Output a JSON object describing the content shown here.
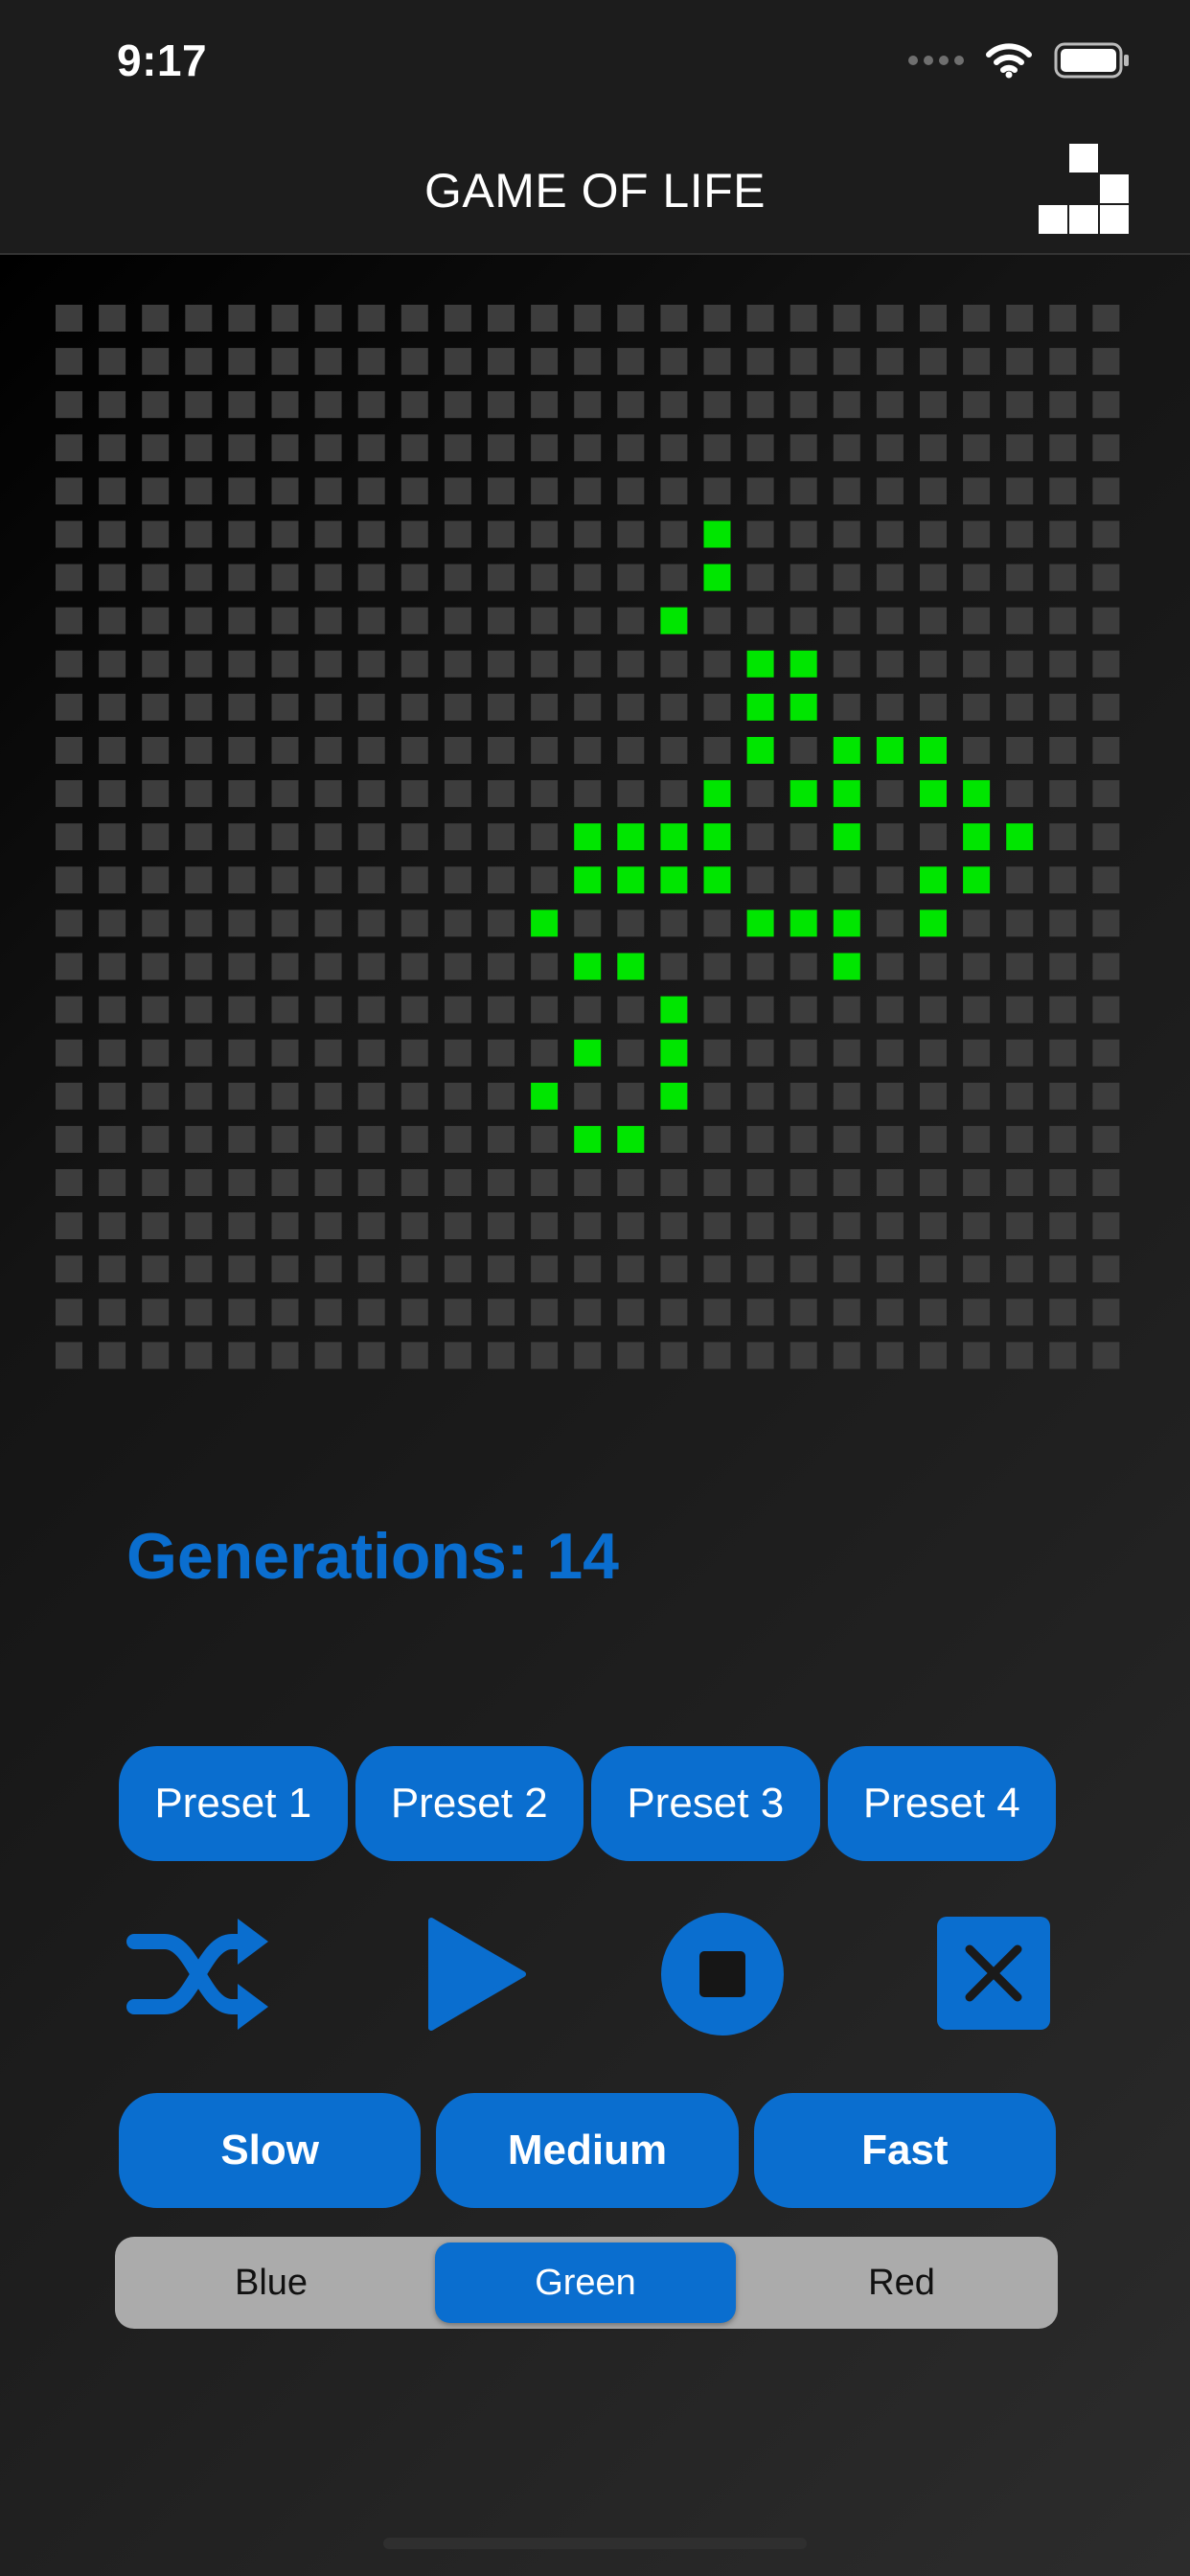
{
  "status": {
    "time": "9:17"
  },
  "nav": {
    "title": "GAME OF LIFE",
    "icon": "blocks-icon"
  },
  "grid": {
    "rows": 25,
    "cols": 25,
    "alive_color": "#00e600",
    "dead_color": "#3d3d3d",
    "alive_cells": [
      [
        5,
        15
      ],
      [
        6,
        15
      ],
      [
        7,
        14
      ],
      [
        8,
        16
      ],
      [
        8,
        17
      ],
      [
        9,
        16
      ],
      [
        9,
        17
      ],
      [
        10,
        16
      ],
      [
        10,
        18
      ],
      [
        10,
        19
      ],
      [
        10,
        20
      ],
      [
        11,
        15
      ],
      [
        11,
        17
      ],
      [
        11,
        18
      ],
      [
        11,
        20
      ],
      [
        11,
        21
      ],
      [
        12,
        12
      ],
      [
        12,
        13
      ],
      [
        12,
        14
      ],
      [
        12,
        15
      ],
      [
        12,
        18
      ],
      [
        12,
        21
      ],
      [
        12,
        22
      ],
      [
        13,
        12
      ],
      [
        13,
        13
      ],
      [
        13,
        14
      ],
      [
        13,
        15
      ],
      [
        13,
        20
      ],
      [
        13,
        21
      ],
      [
        14,
        11
      ],
      [
        14,
        16
      ],
      [
        14,
        17
      ],
      [
        14,
        18
      ],
      [
        14,
        20
      ],
      [
        15,
        12
      ],
      [
        15,
        13
      ],
      [
        15,
        18
      ],
      [
        16,
        14
      ],
      [
        17,
        12
      ],
      [
        17,
        14
      ],
      [
        18,
        11
      ],
      [
        18,
        14
      ],
      [
        19,
        12
      ],
      [
        19,
        13
      ]
    ]
  },
  "generations_text": "Generations: 14",
  "presets": [
    "Preset 1",
    "Preset 2",
    "Preset 3",
    "Preset 4"
  ],
  "controls": [
    "shuffle-icon",
    "play-icon",
    "stop-icon",
    "clear-icon"
  ],
  "speeds": [
    "Slow",
    "Medium",
    "Fast"
  ],
  "colors": {
    "options": [
      "Blue",
      "Green",
      "Red"
    ],
    "selected": "Green"
  },
  "accent": "#0a6ecf"
}
